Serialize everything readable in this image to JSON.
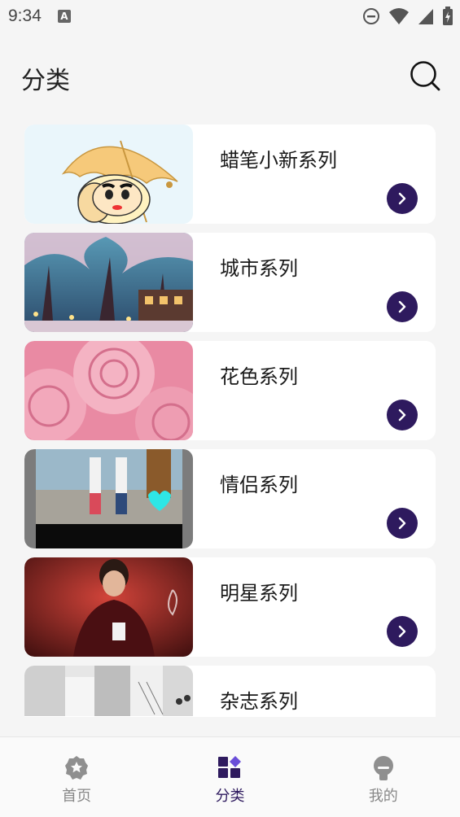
{
  "status_bar": {
    "time": "9:34",
    "notification_glyph": "A"
  },
  "header": {
    "title": "分类",
    "search_icon": "search-icon"
  },
  "categories": [
    {
      "name": "蜡笔小新系列",
      "thumb": "crayon-shinchan-umbrella"
    },
    {
      "name": "城市系列",
      "thumb": "city-night-snow-trees"
    },
    {
      "name": "花色系列",
      "thumb": "pink-roses"
    },
    {
      "name": "情侣系列",
      "thumb": "couple-street"
    },
    {
      "name": "明星系列",
      "thumb": "celebrity-portrait-red"
    },
    {
      "name": "杂志系列",
      "thumb": "magazine-collage"
    }
  ],
  "bottom_nav": [
    {
      "label": "首页",
      "icon": "badge-star-icon",
      "active": false
    },
    {
      "label": "分类",
      "icon": "grid-category-icon",
      "active": true
    },
    {
      "label": "我的",
      "icon": "profile-icon",
      "active": false
    }
  ],
  "colors": {
    "accent": "#2e1a5e",
    "background": "#f5f5f5",
    "card": "#ffffff",
    "inactive": "#888888"
  }
}
